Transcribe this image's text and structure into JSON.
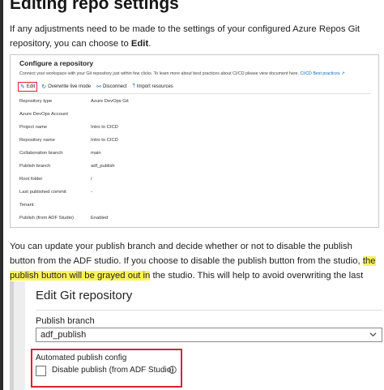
{
  "document": {
    "title": "Editing repo settings",
    "intro": {
      "before": "If any adjustments need to be made to the settings of your configured Azure Repos Git repository, you can choose to ",
      "bold": "Edit",
      "after": "."
    },
    "para2": {
      "before": "You can update your publish branch and decide whether or not to disable the publish button from the ADF studio. If you choose to disable the publish button from the studio, ",
      "highlight": "the publish button will be grayed out in",
      "after": " the studio. This will help to avoid overwriting the last automated publish deployment."
    }
  },
  "configure_repository": {
    "title": "Configure a repository",
    "description": "Connect your workspace with your Git repository just within few clicks. To learn more about best practices about CI/CD please view document here.",
    "description_link": "CI/CD Best practices",
    "toolbar": {
      "edit": "Edit",
      "overwrite": "Overwrite live mode",
      "disconnect": "Disconnect",
      "import": "Import resources"
    },
    "rows": [
      {
        "key": "Repository type",
        "value": "Azure DevOps Git"
      },
      {
        "key": "Azure DevOps Account",
        "value": ""
      },
      {
        "key": "Project name",
        "value": "Intro to CICD"
      },
      {
        "key": "Repository name",
        "value": "Intro to CICD"
      },
      {
        "key": "Collaboration branch",
        "value": "main"
      },
      {
        "key": "Publish branch",
        "value": "adf_publish"
      },
      {
        "key": "Root folder",
        "value": "/"
      },
      {
        "key": "Last published commit",
        "value": "-"
      },
      {
        "key": "Tenant",
        "value": ""
      },
      {
        "key": "Publish (from ADF Studio)",
        "value": "Enabled"
      }
    ]
  },
  "edit_git": {
    "title": "Edit Git repository",
    "publish_branch_label": "Publish branch",
    "publish_branch_value": "adf_publish",
    "automated_publish_label": "Automated publish config",
    "disable_publish_label": "Disable publish (from ADF Studio)",
    "disable_publish_checked": false
  },
  "colors": {
    "highlight": "#fff35c",
    "callout_red": "#d9232f",
    "link_blue": "#0b6cbd"
  }
}
